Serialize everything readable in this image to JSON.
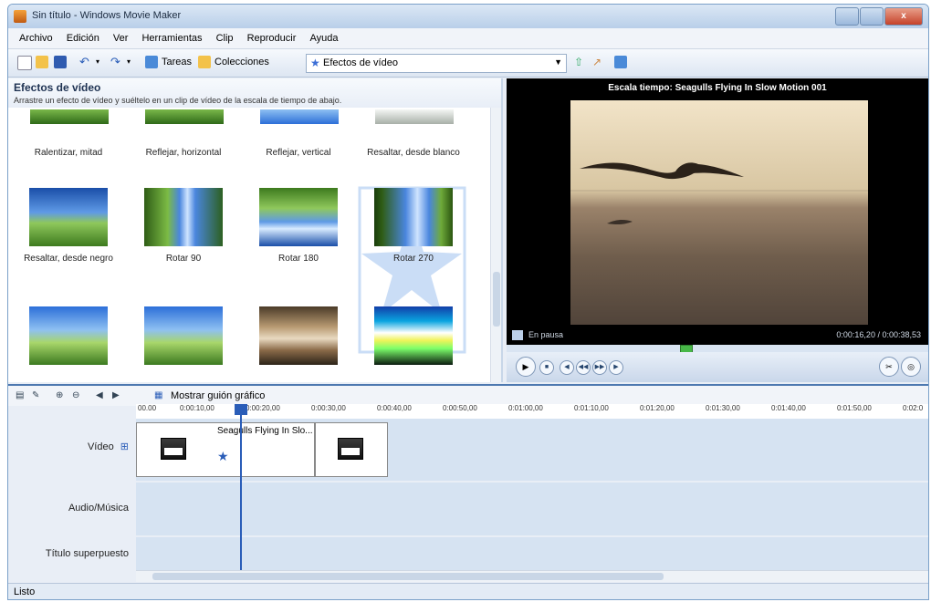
{
  "window": {
    "title": "Sin título - Windows Movie Maker",
    "buttons": {
      "close": "x"
    }
  },
  "menu": [
    "Archivo",
    "Edición",
    "Ver",
    "Herramientas",
    "Clip",
    "Reproducir",
    "Ayuda"
  ],
  "toolbar": {
    "tasks_label": "Tareas",
    "collections_label": "Colecciones",
    "effects_combo": "Efectos de vídeo"
  },
  "effects_pane": {
    "title": "Efectos de vídeo",
    "subtitle": "Arrastre un efecto de vídeo y suéltelo en un clip de vídeo de la escala de tiempo de abajo.",
    "row1": [
      "Ralentizar, mitad",
      "Reflejar, horizontal",
      "Reflejar, vertical",
      "Resaltar, desde blanco"
    ],
    "row2": [
      "Resaltar, desde negro",
      "Rotar 90",
      "Rotar 180",
      "Rotar 270"
    ]
  },
  "preview": {
    "title": "Escala tiempo: Seagulls Flying In Slow Motion 001",
    "status": "En pausa",
    "time": "0:00:16,20 / 0:00:38,53"
  },
  "timeline": {
    "storyboard_label": "Mostrar guión gráfico",
    "ticks": [
      "00.00",
      "0:00:10,00",
      "0:00:20,00",
      "0:00:30,00",
      "0:00:40,00",
      "0:00:50,00",
      "0:01:00,00",
      "0:01:10,00",
      "0:01:20,00",
      "0:01:30,00",
      "0:01:40,00",
      "0:01:50,00",
      "0:02:0"
    ],
    "tracks": {
      "video": "Vídeo",
      "audio": "Audio/Música",
      "title_overlay": "Título superpuesto"
    },
    "clip_title": "Seagulls Flying In Slo..."
  },
  "status_bar": "Listo"
}
